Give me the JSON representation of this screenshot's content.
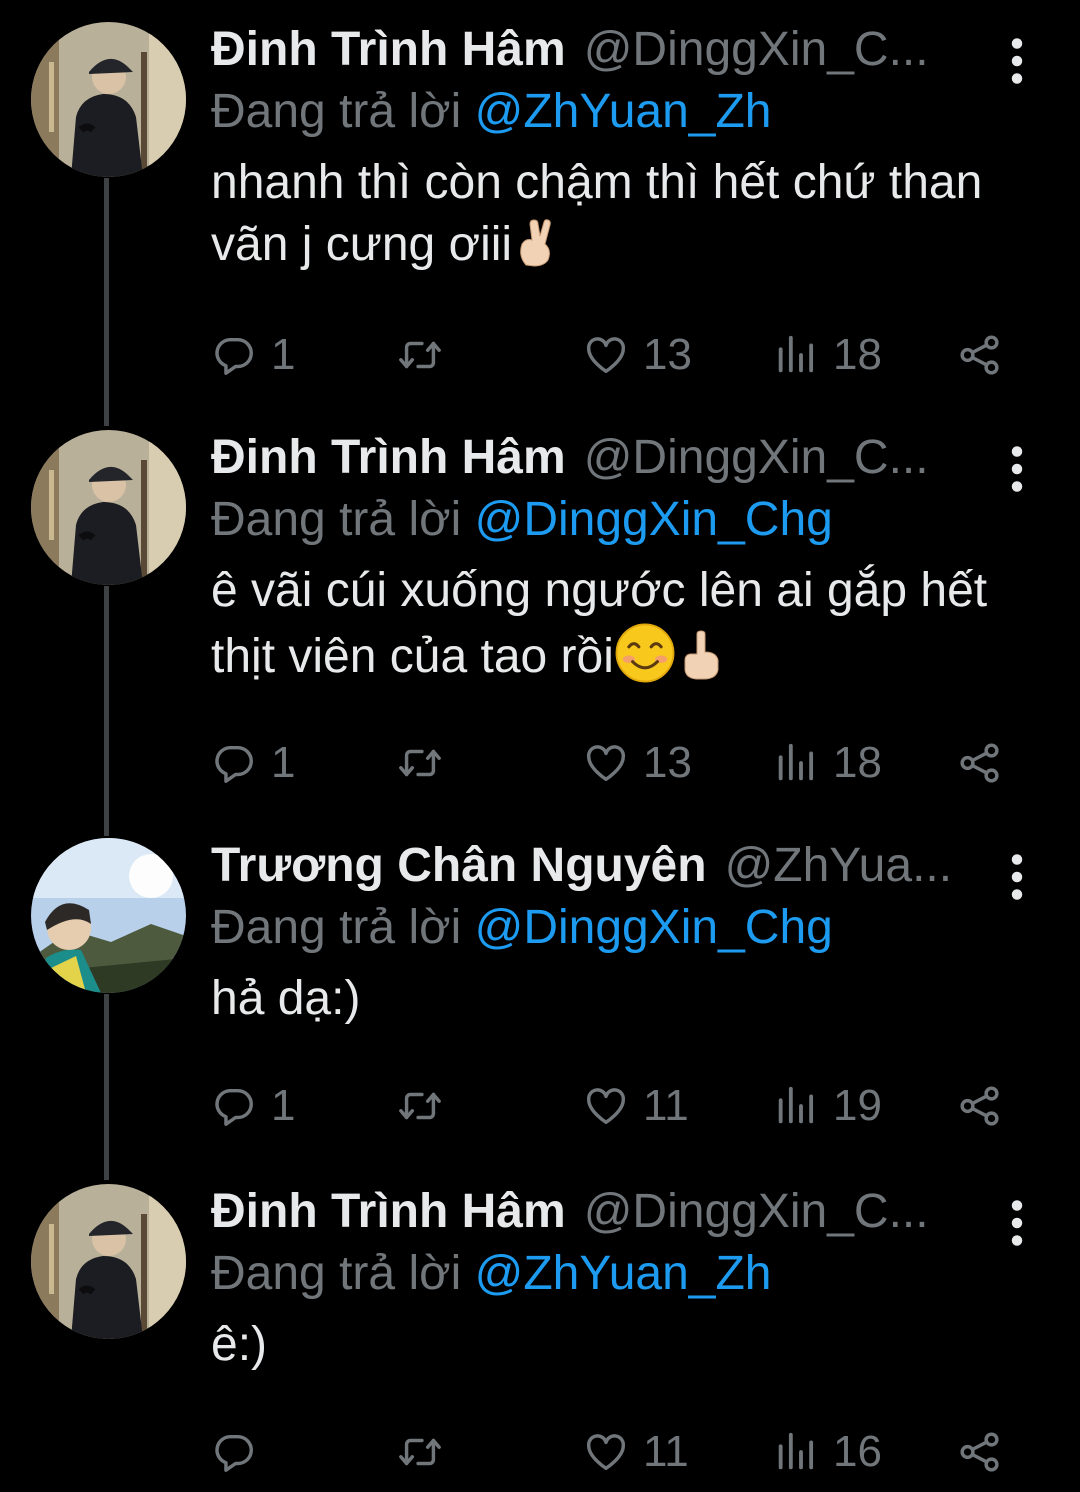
{
  "labels": {
    "replying_prefix": "Đang trả lời"
  },
  "colors": {
    "background": "#000000",
    "text": "#e7e9ea",
    "muted": "#71767b",
    "mention": "#1d9bf0",
    "thread_line": "#3e4144"
  },
  "tweets": [
    {
      "display_name": "Đinh Trình Hâm",
      "handle": "@DinggXin_C...",
      "replying_to": "@ZhYuan_Zh",
      "text": "nhanh thì còn chậm thì hết chứ than vãn j cưng ơiii",
      "emojis": [
        "crossed-fingers-emoji"
      ],
      "replies": "1",
      "retweets": "",
      "likes": "13",
      "views": "18"
    },
    {
      "display_name": "Đinh Trình Hâm",
      "handle": "@DinggXin_C...",
      "replying_to": "@DinggXin_Chg",
      "text": "ê vãi cúi xuống ngước lên ai gắp hết thịt viên của tao rồi",
      "emojis": [
        "smiling-face-emoji",
        "pointing-up-emoji"
      ],
      "replies": "1",
      "retweets": "",
      "likes": "13",
      "views": "18"
    },
    {
      "display_name": "Trương Chân Nguyên",
      "handle": "@ZhYua...",
      "replying_to": "@DinggXin_Chg",
      "text": "hả dạ:)",
      "emojis": [],
      "replies": "1",
      "retweets": "",
      "likes": "11",
      "views": "19"
    },
    {
      "display_name": "Đinh Trình Hâm",
      "handle": "@DinggXin_C...",
      "replying_to": "@ZhYuan_Zh",
      "text": "ê:)",
      "emojis": [],
      "replies": "",
      "retweets": "",
      "likes": "11",
      "views": "16"
    }
  ]
}
